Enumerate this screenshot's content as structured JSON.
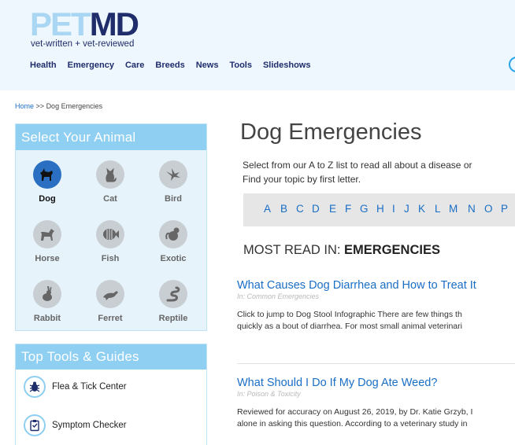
{
  "logo": {
    "pet": "PET",
    "md": "MD",
    "tagline": "vet-written + vet-reviewed"
  },
  "nav": [
    "Health",
    "Emergency",
    "Care",
    "Breeds",
    "News",
    "Tools",
    "Slideshows"
  ],
  "breadcrumb": {
    "home": "Home",
    "separator": ">>",
    "current": "Dog Emergencies"
  },
  "animal_panel": {
    "title": "Select Your Animal",
    "animals": [
      {
        "label": "Dog",
        "icon": "dog-icon",
        "active": true
      },
      {
        "label": "Cat",
        "icon": "cat-icon",
        "active": false
      },
      {
        "label": "Bird",
        "icon": "bird-icon",
        "active": false
      },
      {
        "label": "Horse",
        "icon": "horse-icon",
        "active": false
      },
      {
        "label": "Fish",
        "icon": "fish-icon",
        "active": false
      },
      {
        "label": "Exotic",
        "icon": "exotic-icon",
        "active": false
      },
      {
        "label": "Rabbit",
        "icon": "rabbit-icon",
        "active": false
      },
      {
        "label": "Ferret",
        "icon": "ferret-icon",
        "active": false
      },
      {
        "label": "Reptile",
        "icon": "reptile-icon",
        "active": false
      }
    ]
  },
  "tools_panel": {
    "title": "Top Tools & Guides",
    "items": [
      {
        "label": "Flea & Tick Center",
        "icon": "bug-icon"
      },
      {
        "label": "Symptom Checker",
        "icon": "clipboard-icon"
      }
    ]
  },
  "main": {
    "title": "Dog Emergencies",
    "intro_line1": "Select from our A to Z list to read all about a disease or",
    "intro_line2": "Find your topic by first letter.",
    "letters": [
      "A",
      "B",
      "C",
      "D",
      "E",
      "F",
      "G",
      "H",
      "I",
      "J",
      "K",
      "L",
      "M",
      "N",
      "O",
      "P"
    ],
    "most_read_prefix": "MOST READ IN: ",
    "most_read_category": "EMERGENCIES",
    "articles": [
      {
        "title": "What Causes Dog Diarrhea and How to Treat It",
        "category": "In: Common Emergencies",
        "excerpt1": "Click to jump to Dog Stool Infographic There are few things th",
        "excerpt2": "quickly as a bout of diarrhea. For most small animal veterinari"
      },
      {
        "title": "What Should I Do If My Dog Ate Weed?",
        "category": "In: Poison & Toxicity",
        "excerpt1": "Reviewed for accuracy on August 26, 2019, by Dr. Katie Grzyb, I",
        "excerpt2": "alone in asking this question. According to a veterinary study in"
      }
    ]
  },
  "colors": {
    "header_bg": "#eef7fd",
    "brand_navy": "#1f2d6b",
    "brand_light": "#a9d6f2",
    "panel_header": "#8ecff2",
    "link_blue": "#1a6ec5",
    "active_animal": "#2a6fc2"
  }
}
